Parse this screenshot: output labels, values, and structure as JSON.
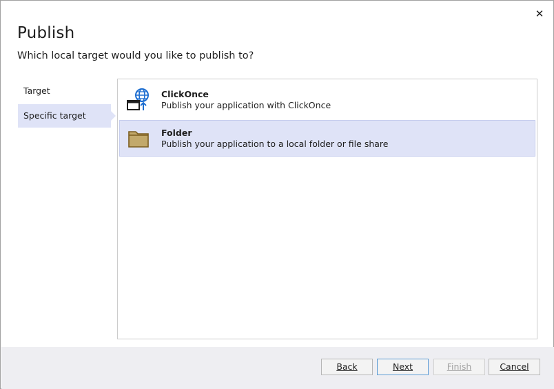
{
  "dialog": {
    "title": "Publish",
    "subtitle": "Which local target would you like to publish to?",
    "close_glyph": "✕"
  },
  "steps": [
    {
      "label": "Target",
      "active": false
    },
    {
      "label": "Specific target",
      "active": true
    }
  ],
  "targets": [
    {
      "name": "ClickOnce",
      "description": "Publish your application with ClickOnce",
      "icon": "clickonce-globe-icon",
      "selected": false
    },
    {
      "name": "Folder",
      "description": "Publish your application to a local folder or file share",
      "icon": "folder-icon",
      "selected": true
    }
  ],
  "buttons": {
    "back": "Back",
    "next": "Next",
    "finish": "Finish",
    "cancel": "Cancel"
  },
  "colors": {
    "selection": "#dfe3f7",
    "footer": "#eeeef2",
    "accent_blue": "#1c6dd0",
    "folder": "#c2a96b"
  }
}
